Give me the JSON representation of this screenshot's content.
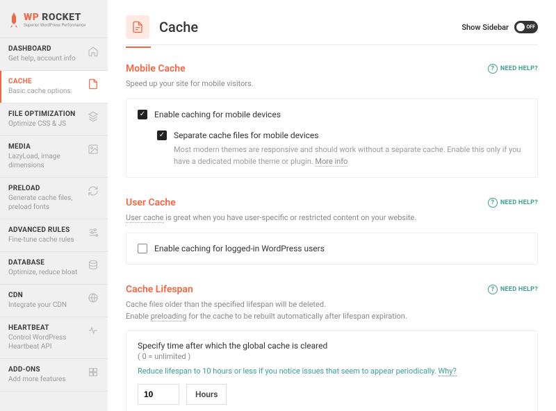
{
  "brand": {
    "wp": "WP",
    "rocket": "ROCKET",
    "tagline": "Superior WordPress Performance"
  },
  "nav": [
    {
      "title": "DASHBOARD",
      "sub": "Get help, account info"
    },
    {
      "title": "CACHE",
      "sub": "Basic cache options"
    },
    {
      "title": "FILE OPTIMIZATION",
      "sub": "Optimize CSS & JS"
    },
    {
      "title": "MEDIA",
      "sub": "LazyLoad, image dimensions"
    },
    {
      "title": "PRELOAD",
      "sub": "Generate cache files, preload fonts"
    },
    {
      "title": "ADVANCED RULES",
      "sub": "Fine-tune cache rules"
    },
    {
      "title": "DATABASE",
      "sub": "Optimize, reduce bloat"
    },
    {
      "title": "CDN",
      "sub": "Integrate your CDN"
    },
    {
      "title": "HEARTBEAT",
      "sub": "Control WordPress Heartbeat API"
    },
    {
      "title": "ADD-ONS",
      "sub": "Add more features"
    }
  ],
  "page": {
    "title": "Cache",
    "show_sidebar": "Show Sidebar",
    "toggle_off": "OFF"
  },
  "help": "NEED HELP?",
  "mobile": {
    "title": "Mobile Cache",
    "desc": "Speed up your site for mobile visitors.",
    "opt1": "Enable caching for mobile devices",
    "opt2": "Separate cache files for mobile devices",
    "opt2_desc": "Most modern themes are responsive and should work without a separate cache. Enable this only if you have a dedicated mobile theme or plugin. ",
    "more": "More info"
  },
  "user": {
    "title": "User Cache",
    "desc_link": "User cache",
    "desc_rest": " is great when you have user-specific or restricted content on your website.",
    "opt1": "Enable caching for logged-in WordPress users"
  },
  "lifespan": {
    "title": "Cache Lifespan",
    "desc1": "Cache files older than the specified lifespan will be deleted.",
    "desc2a": "Enable ",
    "desc2_link": "preloading",
    "desc2b": " for the cache to be rebuilt automatically after lifespan expiration.",
    "panel_title": "Specify time after which the global cache is cleared",
    "panel_sub": "( 0 = unlimited )",
    "tip": "Reduce lifespan to 10 hours or less if you notice issues that seem to appear periodically. ",
    "why": "Why?",
    "value": "10",
    "unit": "Hours"
  }
}
